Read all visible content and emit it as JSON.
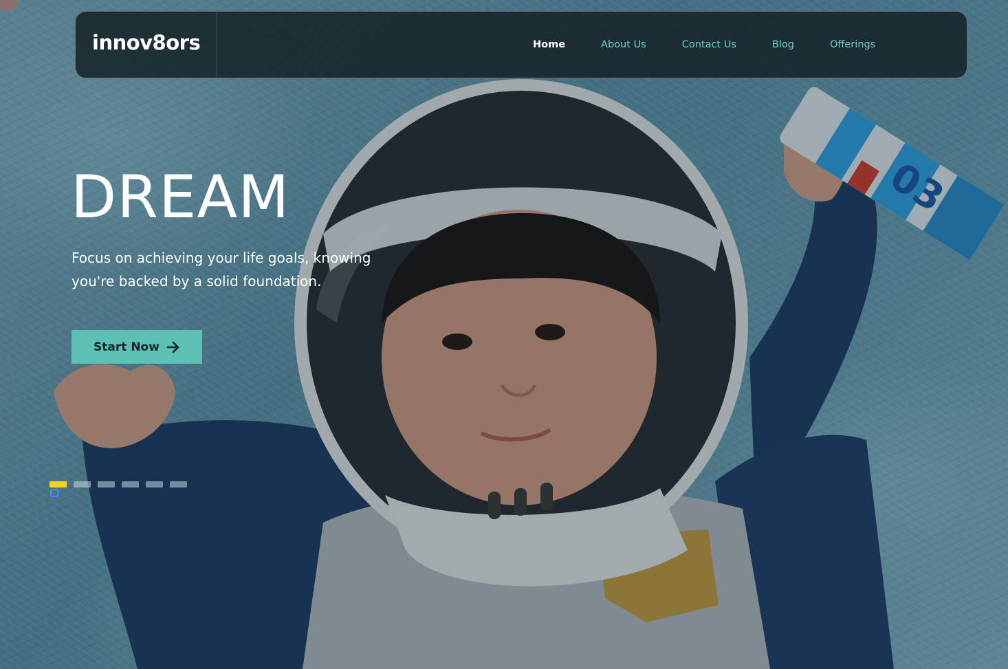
{
  "brand": {
    "logo_text": "innov8ors"
  },
  "nav": {
    "items": [
      {
        "label": "Home",
        "active": true
      },
      {
        "label": "About Us",
        "active": false
      },
      {
        "label": "Contact Us",
        "active": false
      },
      {
        "label": "Blog",
        "active": false
      },
      {
        "label": "Offerings",
        "active": false
      }
    ]
  },
  "hero": {
    "title": "DREAM",
    "subtitle": "Focus on achieving your life goals, knowing you're backed by a solid foundation.",
    "cta_label": "Start Now",
    "cta_icon": "arrow-right-icon"
  },
  "slider": {
    "total_slides": 6,
    "active_index": 0
  },
  "colors": {
    "accent": "#5cc0b5",
    "nav_link": "#6fd0c8",
    "active_dot": "#f5d21e"
  }
}
